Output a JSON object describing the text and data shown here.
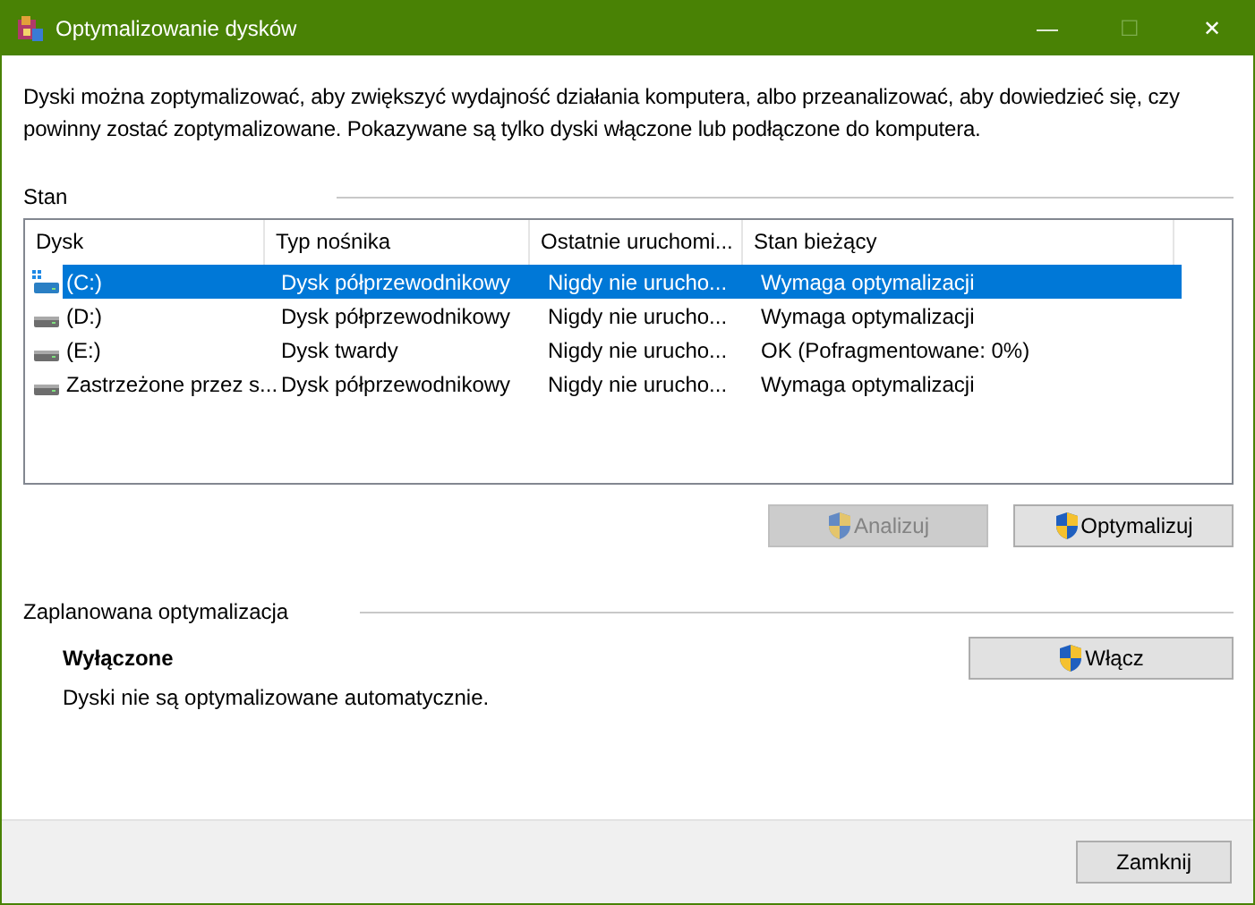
{
  "window": {
    "title": "Optymalizowanie dysków",
    "buttons": [
      "—",
      "☐",
      "✕"
    ]
  },
  "description": "Dyski można zoptymalizować, aby zwiększyć wydajność działania komputera, albo przeanalizować, aby dowiedzieć się, czy powinny zostać zoptymalizowane. Pokazywane są tylko dyski włączone lub podłączone do komputera.",
  "status_section": {
    "title": "Stan",
    "table": {
      "columns": [
        "Dysk",
        "Typ nośnika",
        "Ostatnie uruchomi...",
        "Stan bieżący"
      ],
      "rows": [
        {
          "kind": "system",
          "selected": true,
          "cells": [
            "(C:)",
            "Dysk półprzewodnikowy",
            "Nigdy nie urucho...",
            "Wymaga optymalizacji"
          ]
        },
        {
          "kind": "drive",
          "selected": false,
          "cells": [
            "(D:)",
            "Dysk półprzewodnikowy",
            "Nigdy nie urucho...",
            "Wymaga optymalizacji"
          ]
        },
        {
          "kind": "drive",
          "selected": false,
          "cells": [
            "(E:)",
            "Dysk twardy",
            "Nigdy nie urucho...",
            "OK (Pofragmentowane: 0%)"
          ]
        },
        {
          "kind": "drive",
          "selected": false,
          "cells": [
            "Zastrzeżone przez s...",
            "Dysk półprzewodnikowy",
            "Nigdy nie urucho...",
            "Wymaga optymalizacji"
          ]
        }
      ]
    },
    "buttons": [
      {
        "label": "Analizuj",
        "disabled": true
      },
      {
        "label": "Optymalizuj",
        "disabled": false
      }
    ]
  },
  "schedule_section": {
    "title": "Zaplanowana optymalizacja",
    "state": "Wyłączone",
    "note": "Dyski nie są optymalizowane automatycznie.",
    "button": {
      "label": "Włącz"
    }
  },
  "footer": {
    "button": "Zamknij"
  }
}
